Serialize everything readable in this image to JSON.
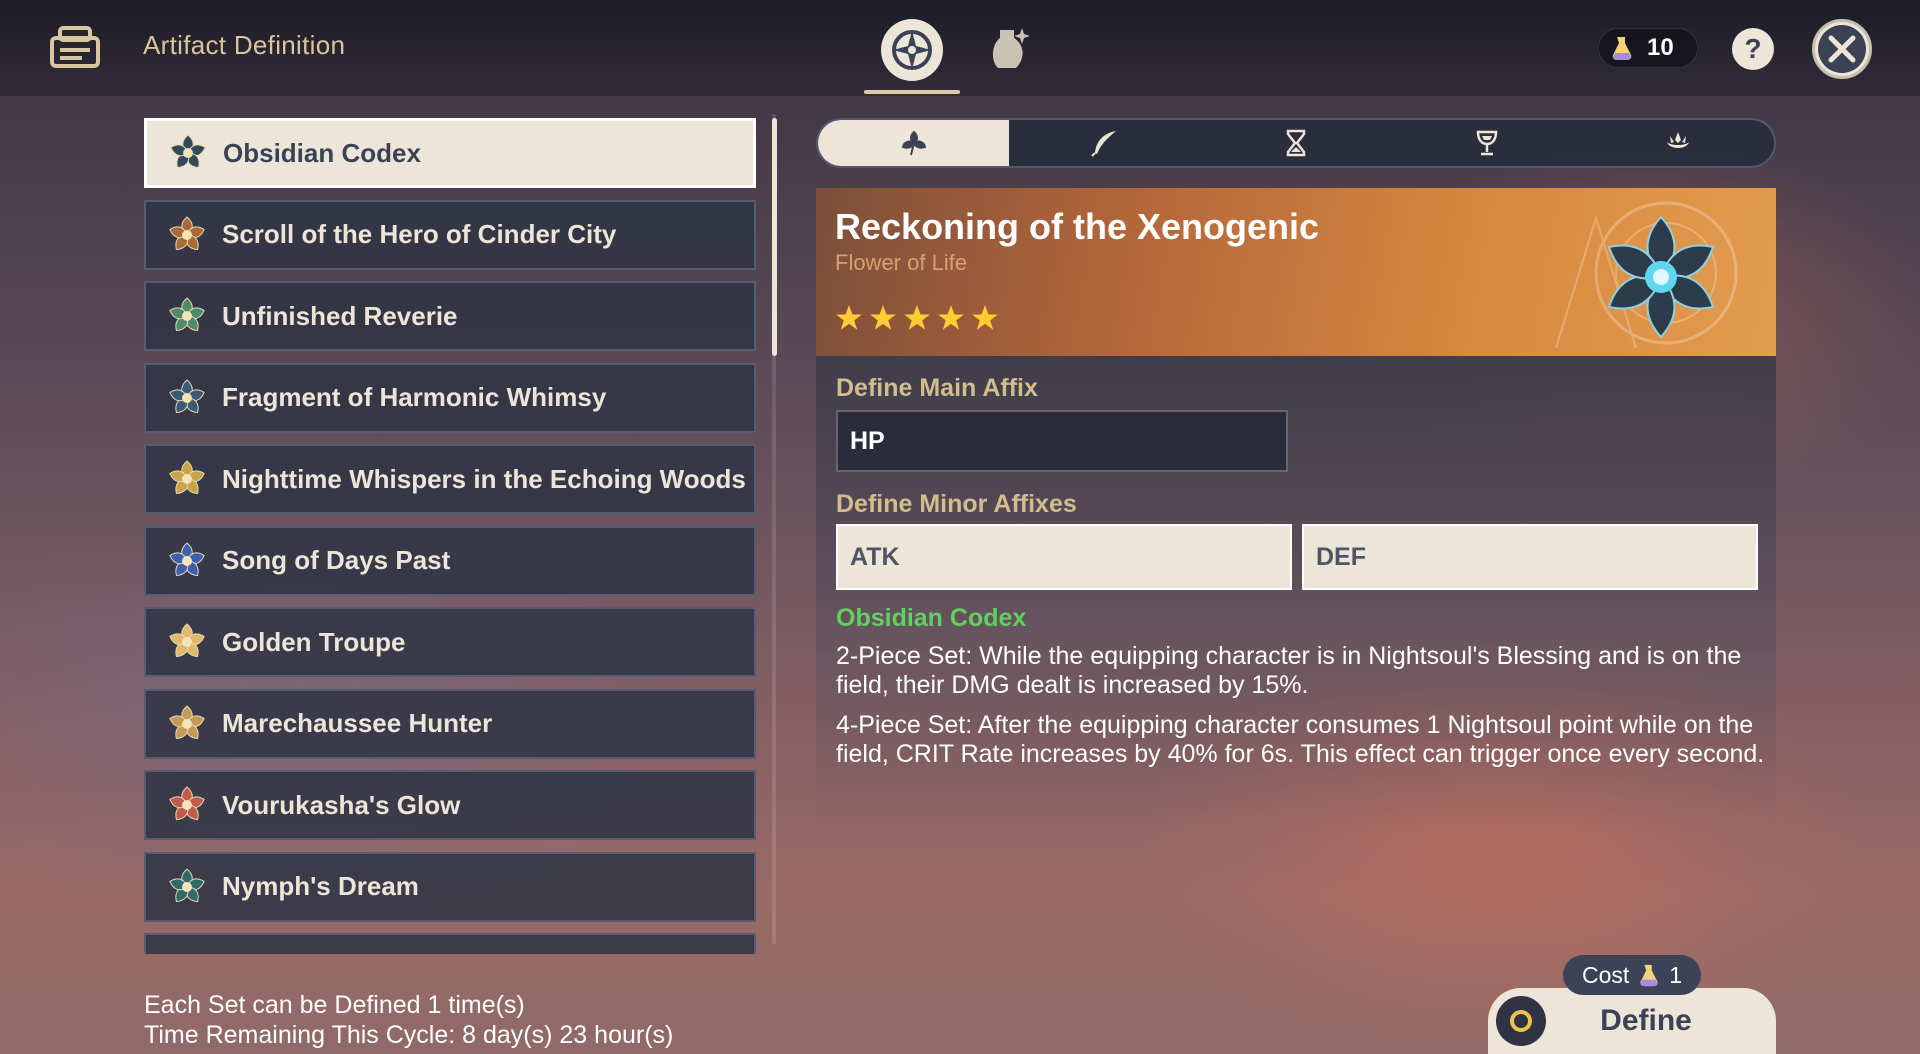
{
  "header": {
    "title": "Artifact Definition",
    "tabs": [
      {
        "icon": "artifact-compass-icon",
        "active": true
      },
      {
        "icon": "vase-icon",
        "active": false
      }
    ],
    "currency": {
      "icon": "elixir-icon",
      "value": "10"
    },
    "help_label": "?",
    "close_icon": "close-icon"
  },
  "sets": [
    {
      "name": "Obsidian Codex",
      "selected": true,
      "color": "#2f4a5a"
    },
    {
      "name": "Scroll of the Hero of Cinder City",
      "color": "#a86a3a"
    },
    {
      "name": "Unfinished Reverie",
      "color": "#4f8a6a"
    },
    {
      "name": "Fragment of Harmonic Whimsy",
      "color": "#3a5a7a"
    },
    {
      "name": "Nighttime Whispers in the Echoing Woods",
      "color": "#c9a54a"
    },
    {
      "name": "Song of Days Past",
      "color": "#3e5fb0"
    },
    {
      "name": "Golden Troupe",
      "color": "#e0b870"
    },
    {
      "name": "Marechaussee Hunter",
      "color": "#c49a5a"
    },
    {
      "name": "Vourukasha's Glow",
      "color": "#c05a4a"
    },
    {
      "name": "Nymph's Dream",
      "color": "#2f6a6a"
    }
  ],
  "slot_tabs": [
    {
      "icon": "flower-icon",
      "active": true
    },
    {
      "icon": "plume-icon",
      "active": false
    },
    {
      "icon": "hourglass-icon",
      "active": false
    },
    {
      "icon": "goblet-icon",
      "active": false
    },
    {
      "icon": "circlet-icon",
      "active": false
    }
  ],
  "artifact": {
    "name": "Reckoning of the Xenogenic",
    "slot": "Flower of Life",
    "rarity": 5
  },
  "main_affix": {
    "title": "Define Main Affix",
    "value": "HP"
  },
  "minor_affixes": {
    "title": "Define Minor Affixes",
    "values": [
      "ATK",
      "DEF"
    ]
  },
  "set_bonus": {
    "name": "Obsidian Codex",
    "two_piece": "2-Piece Set: While the equipping character is in Nightsoul's Blessing and is on the field, their DMG dealt is increased by 15%.",
    "four_piece": "4-Piece Set: After the equipping character consumes 1 Nightsoul point while on the field, CRIT Rate increases by 40% for 6s. This effect can trigger once every second."
  },
  "footer": {
    "line1": "Each Set can be Defined 1 time(s)",
    "line2": "Time Remaining This Cycle: 8 day(s) 23 hour(s)"
  },
  "define": {
    "cost_label": "Cost",
    "cost_value": "1",
    "button_label": "Define"
  }
}
